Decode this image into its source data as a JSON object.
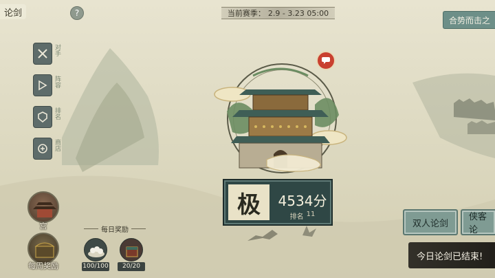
{
  "header": {
    "title": "论剑",
    "help_symbol": "?",
    "season_label": "当前赛季：",
    "season_range": "2.9 - 3.23 05:00",
    "synergy_button": "合势而击之"
  },
  "side_menu": {
    "items": [
      {
        "icon": "crossed-swords-icon",
        "label": "对手"
      },
      {
        "icon": "flag-icon",
        "label": "阵容"
      },
      {
        "icon": "ranking-icon",
        "label": "排名"
      },
      {
        "icon": "shop-icon",
        "label": "商店"
      }
    ]
  },
  "emblem": {
    "notification_icon": "chat-bubble-icon"
  },
  "rank_card": {
    "tier": "极",
    "score": "4534分",
    "rank_label": "排名",
    "rank_value": "11"
  },
  "bottom_left": {
    "palace_label": "宫",
    "weekly_label": "每周奖励",
    "daily_title": "每日奖励",
    "daily_rewards": [
      {
        "icon": "food-plate-icon",
        "count": "100/100"
      },
      {
        "icon": "treasure-box-icon",
        "count": "20/20"
      }
    ]
  },
  "bottom_right": {
    "duo_button": "双人论剑",
    "guest_button": "侠客论",
    "ended_notice": "今日论剑已结束!"
  },
  "colors": {
    "accent_teal": "#6d8f88",
    "plaque": "#2f4745",
    "notification_red": "#c9402f"
  }
}
